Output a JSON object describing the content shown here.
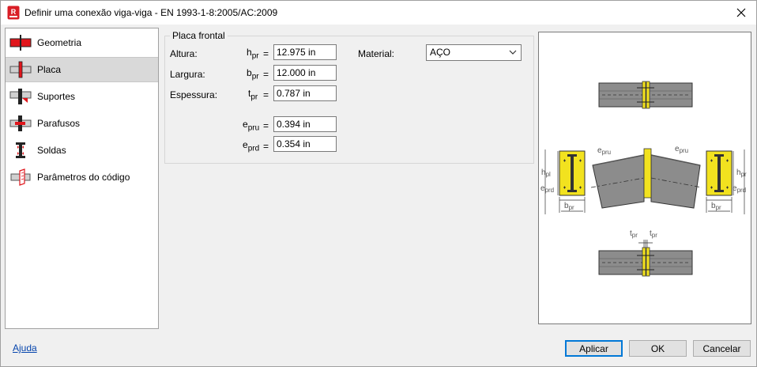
{
  "window": {
    "title": "Definir uma conexão viga-viga - EN 1993-1-8:2005/AC:2009",
    "app_icon_letter": "R"
  },
  "sidebar": {
    "items": [
      {
        "label": "Geometria",
        "icon": "beam-geometry-icon"
      },
      {
        "label": "Placa",
        "icon": "plate-icon",
        "selected": true
      },
      {
        "label": "Suportes",
        "icon": "supports-icon"
      },
      {
        "label": "Parafusos",
        "icon": "bolts-icon"
      },
      {
        "label": "Soldas",
        "icon": "welds-icon"
      },
      {
        "label": "Parâmetros do código",
        "icon": "code-parameters-icon"
      }
    ]
  },
  "plate": {
    "group_title": "Placa frontal",
    "height": {
      "label": "Altura:",
      "sym": "h",
      "sub": "pr",
      "value": "12.975 in"
    },
    "width": {
      "label": "Largura:",
      "sym": "b",
      "sub": "pr",
      "value": "12.000 in"
    },
    "thickness": {
      "label": "Espessura:",
      "sym": "t",
      "sub": "pr",
      "value": "0.787 in"
    },
    "epru": {
      "sym": "e",
      "sub": "pru",
      "value": "0.394 in"
    },
    "eprd": {
      "sym": "e",
      "sub": "prd",
      "value": "0.354 in"
    },
    "eq": "=",
    "material": {
      "label": "Material:",
      "value": "AÇO"
    }
  },
  "diagram": {
    "labels": {
      "e": "e",
      "pru": "pru",
      "prd": "prd",
      "h": "h",
      "pl": "pl",
      "pr": "pr",
      "b": "b",
      "t": "t"
    }
  },
  "footer": {
    "help": "Ajuda",
    "apply": "Aplicar",
    "ok": "OK",
    "cancel": "Cancelar"
  },
  "colors": {
    "accent": "#0078d7",
    "plate_yellow": "#f2e21f",
    "beam_gray": "#8c8c8c",
    "icon_red": "#e0151b"
  }
}
